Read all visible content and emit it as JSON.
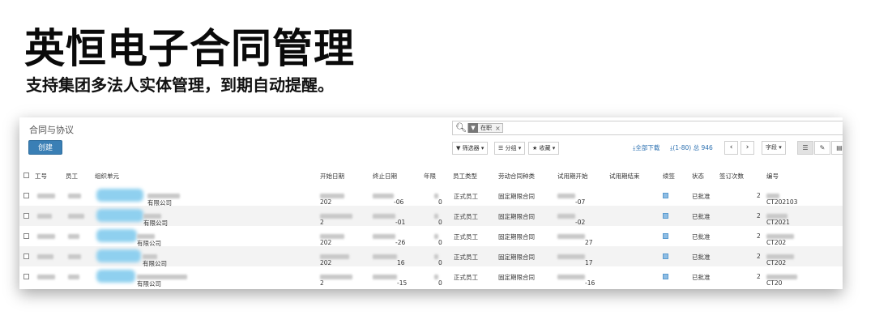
{
  "headline": "英恒电子合同管理",
  "subline": "支持集团多法人实体管理，到期自动提醒。",
  "app": {
    "breadcrumb": "合同与协议",
    "create_label": "创建",
    "search": {
      "icon": "search-icon",
      "facet_icon": "filter-icon",
      "facet_label": "在职",
      "facet_close": "×"
    },
    "toolbar": {
      "filter_label": "▼ 筛选器 ▾",
      "group_label": "☰ 分组 ▾",
      "favorite_label": "★ 收藏 ▾",
      "download_all": "全部下载",
      "pager_text": "(1-80) 总 946",
      "prev": "‹",
      "next": "›",
      "fields_label": "字段 ▾",
      "view_list": "☰",
      "view_form": "✎",
      "view_other": "▤"
    },
    "columns": [
      "工号",
      "员工",
      "组织单元",
      "开始日期",
      "终止日期",
      "年限",
      "员工类型",
      "劳动合同种类",
      "试用期开始",
      "试用期结束",
      "续签",
      "状态",
      "签订次数",
      "编号"
    ],
    "rows": [
      {
        "org_tail": "有限公司",
        "start": "202",
        "end_tail": "-06",
        "years": "0",
        "type": "正式员工",
        "kind": "固定期限合同",
        "trial_tail": "-07",
        "status": "已批准",
        "count": "2",
        "code": "CT202103"
      },
      {
        "org_tail": "有限公司",
        "start": "2",
        "end_tail": "-01",
        "years": "0",
        "type": "正式员工",
        "kind": "固定期限合同",
        "trial_tail": "-02",
        "status": "已批准",
        "count": "2",
        "code": "CT2021"
      },
      {
        "org_tail": "有限公司",
        "start": "202",
        "end_tail": "-26",
        "years": "0",
        "type": "正式员工",
        "kind": "固定期限合同",
        "trial_tail": "27",
        "status": "已批准",
        "count": "2",
        "code": "CT202"
      },
      {
        "org_tail": "有限公司",
        "start": "202",
        "end_tail": "16",
        "years": "0",
        "type": "正式员工",
        "kind": "固定期限合同",
        "trial_tail": "17",
        "status": "已批准",
        "count": "2",
        "code": "CT202"
      },
      {
        "org_tail": "有限公司",
        "start": "2",
        "end_tail": "-15",
        "years": "0",
        "type": "正式员工",
        "kind": "固定期限合同",
        "trial_tail": "-16",
        "status": "已批准",
        "count": "2",
        "code": "CT20"
      }
    ]
  }
}
